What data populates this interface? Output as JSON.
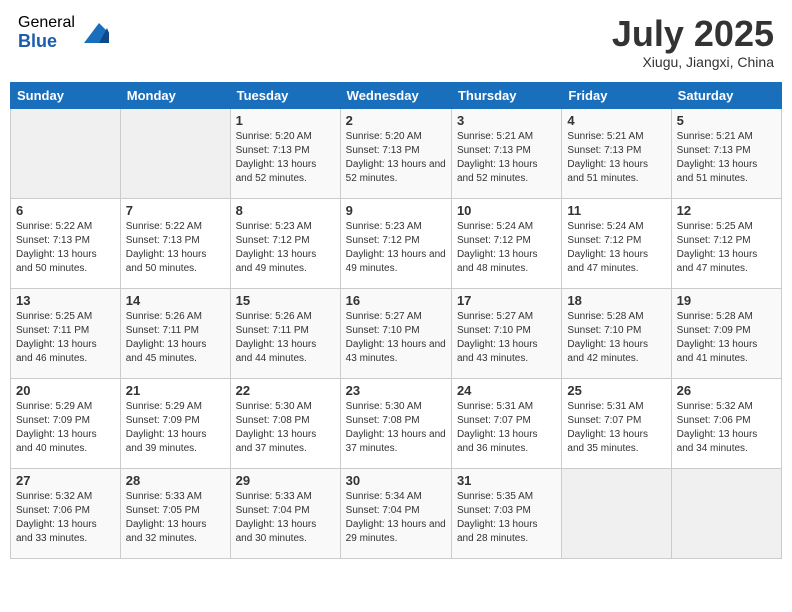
{
  "header": {
    "logo_general": "General",
    "logo_blue": "Blue",
    "month_title": "July 2025",
    "subtitle": "Xiugu, Jiangxi, China"
  },
  "weekdays": [
    "Sunday",
    "Monday",
    "Tuesday",
    "Wednesday",
    "Thursday",
    "Friday",
    "Saturday"
  ],
  "weeks": [
    [
      {
        "day": "",
        "sunrise": "",
        "sunset": "",
        "daylight": ""
      },
      {
        "day": "",
        "sunrise": "",
        "sunset": "",
        "daylight": ""
      },
      {
        "day": "1",
        "sunrise": "Sunrise: 5:20 AM",
        "sunset": "Sunset: 7:13 PM",
        "daylight": "Daylight: 13 hours and 52 minutes."
      },
      {
        "day": "2",
        "sunrise": "Sunrise: 5:20 AM",
        "sunset": "Sunset: 7:13 PM",
        "daylight": "Daylight: 13 hours and 52 minutes."
      },
      {
        "day": "3",
        "sunrise": "Sunrise: 5:21 AM",
        "sunset": "Sunset: 7:13 PM",
        "daylight": "Daylight: 13 hours and 52 minutes."
      },
      {
        "day": "4",
        "sunrise": "Sunrise: 5:21 AM",
        "sunset": "Sunset: 7:13 PM",
        "daylight": "Daylight: 13 hours and 51 minutes."
      },
      {
        "day": "5",
        "sunrise": "Sunrise: 5:21 AM",
        "sunset": "Sunset: 7:13 PM",
        "daylight": "Daylight: 13 hours and 51 minutes."
      }
    ],
    [
      {
        "day": "6",
        "sunrise": "Sunrise: 5:22 AM",
        "sunset": "Sunset: 7:13 PM",
        "daylight": "Daylight: 13 hours and 50 minutes."
      },
      {
        "day": "7",
        "sunrise": "Sunrise: 5:22 AM",
        "sunset": "Sunset: 7:13 PM",
        "daylight": "Daylight: 13 hours and 50 minutes."
      },
      {
        "day": "8",
        "sunrise": "Sunrise: 5:23 AM",
        "sunset": "Sunset: 7:12 PM",
        "daylight": "Daylight: 13 hours and 49 minutes."
      },
      {
        "day": "9",
        "sunrise": "Sunrise: 5:23 AM",
        "sunset": "Sunset: 7:12 PM",
        "daylight": "Daylight: 13 hours and 49 minutes."
      },
      {
        "day": "10",
        "sunrise": "Sunrise: 5:24 AM",
        "sunset": "Sunset: 7:12 PM",
        "daylight": "Daylight: 13 hours and 48 minutes."
      },
      {
        "day": "11",
        "sunrise": "Sunrise: 5:24 AM",
        "sunset": "Sunset: 7:12 PM",
        "daylight": "Daylight: 13 hours and 47 minutes."
      },
      {
        "day": "12",
        "sunrise": "Sunrise: 5:25 AM",
        "sunset": "Sunset: 7:12 PM",
        "daylight": "Daylight: 13 hours and 47 minutes."
      }
    ],
    [
      {
        "day": "13",
        "sunrise": "Sunrise: 5:25 AM",
        "sunset": "Sunset: 7:11 PM",
        "daylight": "Daylight: 13 hours and 46 minutes."
      },
      {
        "day": "14",
        "sunrise": "Sunrise: 5:26 AM",
        "sunset": "Sunset: 7:11 PM",
        "daylight": "Daylight: 13 hours and 45 minutes."
      },
      {
        "day": "15",
        "sunrise": "Sunrise: 5:26 AM",
        "sunset": "Sunset: 7:11 PM",
        "daylight": "Daylight: 13 hours and 44 minutes."
      },
      {
        "day": "16",
        "sunrise": "Sunrise: 5:27 AM",
        "sunset": "Sunset: 7:10 PM",
        "daylight": "Daylight: 13 hours and 43 minutes."
      },
      {
        "day": "17",
        "sunrise": "Sunrise: 5:27 AM",
        "sunset": "Sunset: 7:10 PM",
        "daylight": "Daylight: 13 hours and 43 minutes."
      },
      {
        "day": "18",
        "sunrise": "Sunrise: 5:28 AM",
        "sunset": "Sunset: 7:10 PM",
        "daylight": "Daylight: 13 hours and 42 minutes."
      },
      {
        "day": "19",
        "sunrise": "Sunrise: 5:28 AM",
        "sunset": "Sunset: 7:09 PM",
        "daylight": "Daylight: 13 hours and 41 minutes."
      }
    ],
    [
      {
        "day": "20",
        "sunrise": "Sunrise: 5:29 AM",
        "sunset": "Sunset: 7:09 PM",
        "daylight": "Daylight: 13 hours and 40 minutes."
      },
      {
        "day": "21",
        "sunrise": "Sunrise: 5:29 AM",
        "sunset": "Sunset: 7:09 PM",
        "daylight": "Daylight: 13 hours and 39 minutes."
      },
      {
        "day": "22",
        "sunrise": "Sunrise: 5:30 AM",
        "sunset": "Sunset: 7:08 PM",
        "daylight": "Daylight: 13 hours and 37 minutes."
      },
      {
        "day": "23",
        "sunrise": "Sunrise: 5:30 AM",
        "sunset": "Sunset: 7:08 PM",
        "daylight": "Daylight: 13 hours and 37 minutes."
      },
      {
        "day": "24",
        "sunrise": "Sunrise: 5:31 AM",
        "sunset": "Sunset: 7:07 PM",
        "daylight": "Daylight: 13 hours and 36 minutes."
      },
      {
        "day": "25",
        "sunrise": "Sunrise: 5:31 AM",
        "sunset": "Sunset: 7:07 PM",
        "daylight": "Daylight: 13 hours and 35 minutes."
      },
      {
        "day": "26",
        "sunrise": "Sunrise: 5:32 AM",
        "sunset": "Sunset: 7:06 PM",
        "daylight": "Daylight: 13 hours and 34 minutes."
      }
    ],
    [
      {
        "day": "27",
        "sunrise": "Sunrise: 5:32 AM",
        "sunset": "Sunset: 7:06 PM",
        "daylight": "Daylight: 13 hours and 33 minutes."
      },
      {
        "day": "28",
        "sunrise": "Sunrise: 5:33 AM",
        "sunset": "Sunset: 7:05 PM",
        "daylight": "Daylight: 13 hours and 32 minutes."
      },
      {
        "day": "29",
        "sunrise": "Sunrise: 5:33 AM",
        "sunset": "Sunset: 7:04 PM",
        "daylight": "Daylight: 13 hours and 30 minutes."
      },
      {
        "day": "30",
        "sunrise": "Sunrise: 5:34 AM",
        "sunset": "Sunset: 7:04 PM",
        "daylight": "Daylight: 13 hours and 29 minutes."
      },
      {
        "day": "31",
        "sunrise": "Sunrise: 5:35 AM",
        "sunset": "Sunset: 7:03 PM",
        "daylight": "Daylight: 13 hours and 28 minutes."
      },
      {
        "day": "",
        "sunrise": "",
        "sunset": "",
        "daylight": ""
      },
      {
        "day": "",
        "sunrise": "",
        "sunset": "",
        "daylight": ""
      }
    ]
  ]
}
